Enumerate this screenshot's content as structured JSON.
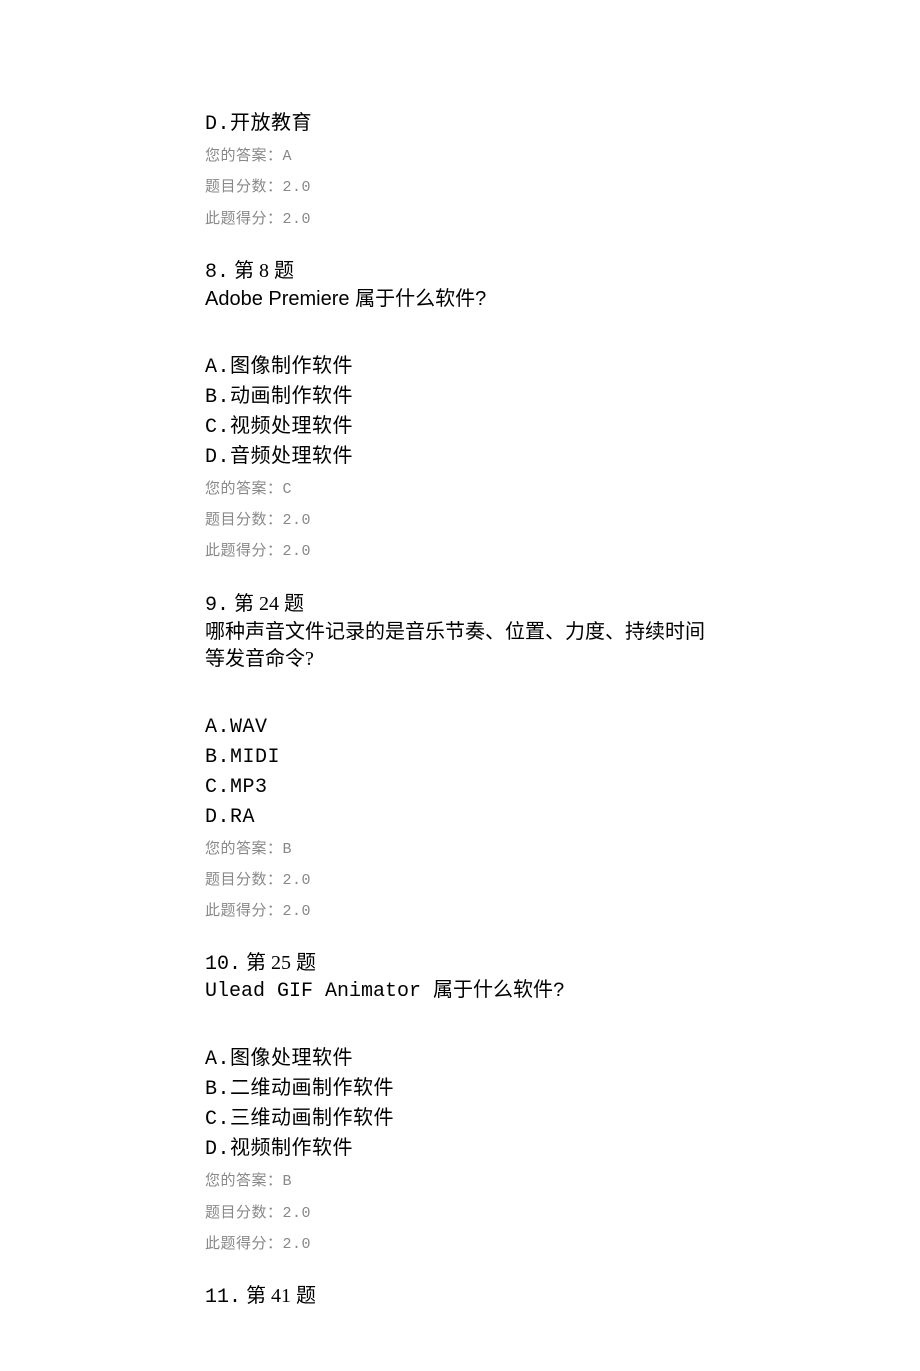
{
  "answer_label_prefix": "您的答案：",
  "question_score_label": "题目分数：",
  "score_label": "此题得分：",
  "q7_tail": {
    "option_d_label": "D.",
    "option_d_text": "开放教育",
    "answer": "A",
    "question_score": "2.0",
    "score": "2.0"
  },
  "q8": {
    "header_num": "8.",
    "header_title": "第 8 题",
    "question": "Adobe Premiere 属于什么软件?",
    "options": [
      {
        "label": "A.",
        "text": "图像制作软件"
      },
      {
        "label": "B.",
        "text": "动画制作软件"
      },
      {
        "label": "C.",
        "text": "视频处理软件"
      },
      {
        "label": "D.",
        "text": "音频处理软件"
      }
    ],
    "answer": "C",
    "question_score": "2.0",
    "score": "2.0"
  },
  "q9": {
    "header_num": "9.",
    "header_title": "第 24 题",
    "question": "哪种声音文件记录的是音乐节奏、位置、力度、持续时间等发音命令?",
    "options": [
      {
        "label": "A.",
        "text": "WAV"
      },
      {
        "label": "B.",
        "text": "MIDI"
      },
      {
        "label": "C.",
        "text": "MP3"
      },
      {
        "label": "D.",
        "text": "RA"
      }
    ],
    "answer": "B",
    "question_score": "2.0",
    "score": "2.0"
  },
  "q10": {
    "header_num": "10.",
    "header_title": "第 25 题",
    "question": "Ulead GIF Animator 属于什么软件?",
    "options": [
      {
        "label": "A.",
        "text": "图像处理软件"
      },
      {
        "label": "B.",
        "text": "二维动画制作软件"
      },
      {
        "label": "C.",
        "text": "三维动画制作软件"
      },
      {
        "label": "D.",
        "text": "视频制作软件"
      }
    ],
    "answer": "B",
    "question_score": "2.0",
    "score": "2.0"
  },
  "q11": {
    "header_num": "11.",
    "header_title": "第 41 题"
  }
}
